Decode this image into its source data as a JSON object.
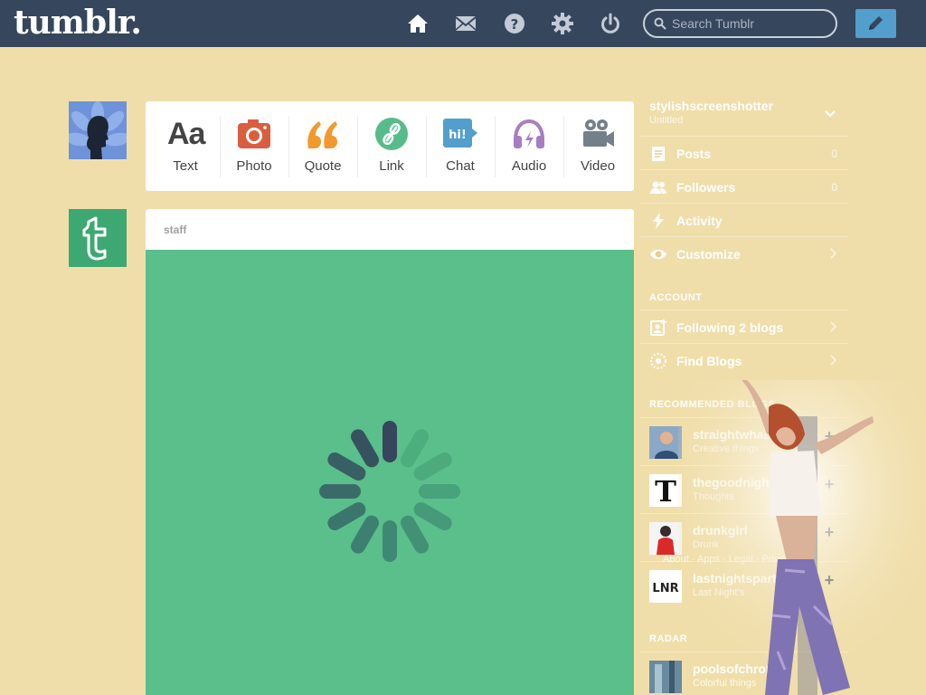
{
  "header": {
    "logo": "tumblr.",
    "icons": [
      "home-icon",
      "mail-icon",
      "help-icon",
      "gear-icon",
      "power-icon"
    ],
    "search_placeholder": "Search Tumblr",
    "compose_icon": "pencil-icon"
  },
  "post_types": [
    {
      "label": "Text",
      "icon": "text-icon",
      "glyph": "Aa",
      "color": "#444444"
    },
    {
      "label": "Photo",
      "icon": "camera-icon",
      "color": "#d95e40"
    },
    {
      "label": "Quote",
      "icon": "quote-icon",
      "color": "#f2992e"
    },
    {
      "label": "Link",
      "icon": "link-icon",
      "color": "#56bc8a"
    },
    {
      "label": "Chat",
      "icon": "chat-icon",
      "glyph": "hi!",
      "color": "#529ecc"
    },
    {
      "label": "Audio",
      "icon": "headphones-icon",
      "color": "#a77dc2"
    },
    {
      "label": "Video",
      "icon": "video-camera-icon",
      "color": "#748089"
    }
  ],
  "post": {
    "author": "staff",
    "background": "#5abf8a"
  },
  "sidebar": {
    "blog": {
      "name": "stylishscreenshotter",
      "title": "Untitled"
    },
    "menu": [
      {
        "label": "Posts",
        "icon": "posts-icon",
        "count": "0"
      },
      {
        "label": "Followers",
        "icon": "followers-icon",
        "count": "0"
      },
      {
        "label": "Activity",
        "icon": "lightning-icon"
      },
      {
        "label": "Customize",
        "icon": "eye-icon"
      }
    ],
    "account_heading": "ACCOUNT",
    "account": [
      {
        "label": "Following 2 blogs",
        "icon": "following-icon"
      },
      {
        "label": "Find Blogs",
        "icon": "compass-icon"
      }
    ],
    "recommended_heading": "RECOMMENDED BLOGS",
    "recommended": [
      {
        "name": "straightwhackity",
        "sub": "Creative things"
      },
      {
        "name": "thegoodnight",
        "sub": "Thoughts"
      },
      {
        "name": "drunkgirl",
        "sub": "Drunk"
      },
      {
        "name": "lastnightsparty",
        "sub": "Last Night's"
      }
    ],
    "radar_heading": "RADAR",
    "radar": [
      {
        "name": "poolsofchrome",
        "sub": "Colorful things"
      }
    ],
    "about_text": "About · Apps · Legal · Privacy"
  },
  "colors": {
    "background": "#f0deaa",
    "topbar": "#36465d",
    "compose": "#529ecc",
    "post_green": "#5abf8a"
  }
}
